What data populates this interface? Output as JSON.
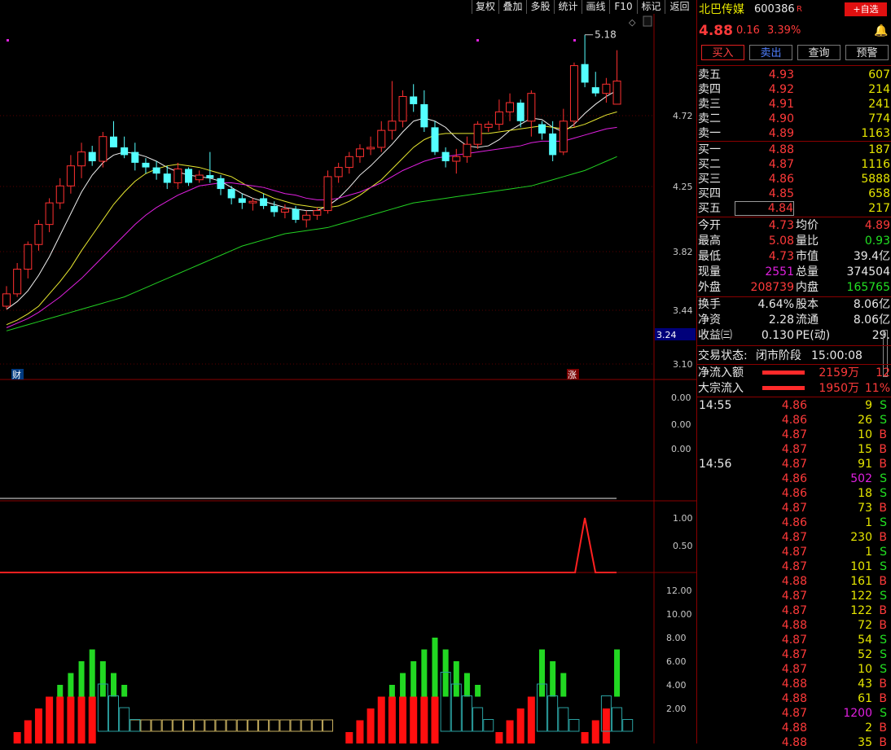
{
  "toolbar": [
    "复权",
    "叠加",
    "多股",
    "统计",
    "画线",
    "F10",
    "标记",
    "返回"
  ],
  "stock": {
    "name": "北巴传媒",
    "code": "600386",
    "flag": "R",
    "add_fav": "+自选",
    "price": "4.88",
    "change": "0.16",
    "pct": "3.39%"
  },
  "actions": [
    "买入",
    "卖出",
    "查询",
    "预警"
  ],
  "sells": [
    {
      "label": "卖五",
      "price": "4.93",
      "vol": "607"
    },
    {
      "label": "卖四",
      "price": "4.92",
      "vol": "214"
    },
    {
      "label": "卖三",
      "price": "4.91",
      "vol": "241"
    },
    {
      "label": "卖二",
      "price": "4.90",
      "vol": "774"
    },
    {
      "label": "卖一",
      "price": "4.89",
      "vol": "1163"
    }
  ],
  "buys": [
    {
      "label": "买一",
      "price": "4.88",
      "vol": "187"
    },
    {
      "label": "买二",
      "price": "4.87",
      "vol": "1116"
    },
    {
      "label": "买三",
      "price": "4.86",
      "vol": "5888"
    },
    {
      "label": "买四",
      "price": "4.85",
      "vol": "658"
    },
    {
      "label": "买五",
      "price": "4.84",
      "vol": "217"
    }
  ],
  "stats1": [
    {
      "l1": "今开",
      "v1": "4.73",
      "l2": "均价",
      "v2": "4.89"
    },
    {
      "l1": "最高",
      "v1": "5.08",
      "l2": "量比",
      "v2": "0.93"
    },
    {
      "l1": "最低",
      "v1": "4.73",
      "l2": "市值",
      "v2": "39.4亿"
    },
    {
      "l1": "现量",
      "v1": "2551",
      "l2": "总量",
      "v2": "374504"
    },
    {
      "l1": "外盘",
      "v1": "208739",
      "l2": "内盘",
      "v2": "165765"
    }
  ],
  "stats2": [
    {
      "l1": "换手",
      "v1": "4.64%",
      "l2": "股本",
      "v2": "8.06亿"
    },
    {
      "l1": "净资",
      "v1": "2.28",
      "l2": "流通",
      "v2": "8.06亿"
    },
    {
      "l1": "收益㈢",
      "v1": "0.130",
      "l2": "PE(动)",
      "v2": "29."
    }
  ],
  "status": {
    "label": "交易状态:",
    "value": "闭市阶段",
    "time": "15:00:08"
  },
  "flows": [
    {
      "label": "净流入额",
      "amount": "2159万",
      "pct": "12"
    },
    {
      "label": "大宗流入",
      "amount": "1950万",
      "pct": "11%"
    }
  ],
  "ticks": [
    {
      "time": "14:55",
      "price": "4.86",
      "vol": "9",
      "side": "S"
    },
    {
      "time": "",
      "price": "4.86",
      "vol": "26",
      "side": "S"
    },
    {
      "time": "",
      "price": "4.87",
      "vol": "10",
      "side": "B"
    },
    {
      "time": "",
      "price": "4.87",
      "vol": "15",
      "side": "B"
    },
    {
      "time": "14:56",
      "price": "4.87",
      "vol": "91",
      "side": "B"
    },
    {
      "time": "",
      "price": "4.86",
      "vol": "502",
      "side": "S"
    },
    {
      "time": "",
      "price": "4.86",
      "vol": "18",
      "side": "S"
    },
    {
      "time": "",
      "price": "4.87",
      "vol": "73",
      "side": "B"
    },
    {
      "time": "",
      "price": "4.86",
      "vol": "1",
      "side": "S"
    },
    {
      "time": "",
      "price": "4.87",
      "vol": "230",
      "side": "B"
    },
    {
      "time": "",
      "price": "4.87",
      "vol": "1",
      "side": "S"
    },
    {
      "time": "",
      "price": "4.87",
      "vol": "101",
      "side": "S"
    },
    {
      "time": "",
      "price": "4.88",
      "vol": "161",
      "side": "B"
    },
    {
      "time": "",
      "price": "4.87",
      "vol": "122",
      "side": "S"
    },
    {
      "time": "",
      "price": "4.87",
      "vol": "122",
      "side": "B"
    },
    {
      "time": "",
      "price": "4.88",
      "vol": "72",
      "side": "B"
    },
    {
      "time": "",
      "price": "4.87",
      "vol": "54",
      "side": "S"
    },
    {
      "time": "",
      "price": "4.87",
      "vol": "52",
      "side": "S"
    },
    {
      "time": "",
      "price": "4.87",
      "vol": "10",
      "side": "S"
    },
    {
      "time": "",
      "price": "4.88",
      "vol": "43",
      "side": "B"
    },
    {
      "time": "",
      "price": "4.88",
      "vol": "61",
      "side": "B"
    },
    {
      "time": "",
      "price": "4.87",
      "vol": "1200",
      "side": "S"
    },
    {
      "time": "",
      "price": "4.88",
      "vol": "2",
      "side": "B"
    },
    {
      "time": "",
      "price": "4.88",
      "vol": "35",
      "side": "B"
    }
  ],
  "chart": {
    "price_axis": [
      "4.72",
      "4.25",
      "3.82",
      "3.44",
      "3.10"
    ],
    "current_price_tag": "3.24",
    "high_label": "5.18",
    "marker_cai": "财",
    "marker_zhang": "涨",
    "panel2_axis": [
      "0.00",
      "0.00",
      "0.00"
    ],
    "panel3_axis": [
      "1.00",
      "0.50"
    ],
    "panel4_axis": [
      "12.00",
      "10.00",
      "8.00",
      "6.00",
      "4.00",
      "2.00"
    ]
  },
  "chart_data": {
    "type": "candlestick",
    "ylim": [
      2.95,
      5.3
    ],
    "candles": [
      [
        3.42,
        3.55,
        3.4,
        3.5
      ],
      [
        3.5,
        3.7,
        3.48,
        3.66
      ],
      [
        3.66,
        3.84,
        3.6,
        3.82
      ],
      [
        3.82,
        3.98,
        3.78,
        3.95
      ],
      [
        3.95,
        4.12,
        3.9,
        4.09
      ],
      [
        4.09,
        4.25,
        4.05,
        4.2
      ],
      [
        4.2,
        4.4,
        4.15,
        4.33
      ],
      [
        4.33,
        4.48,
        4.25,
        4.42
      ],
      [
        4.42,
        4.46,
        4.33,
        4.36
      ],
      [
        4.36,
        4.55,
        4.32,
        4.52
      ],
      [
        4.52,
        4.62,
        4.45,
        4.45
      ],
      [
        4.45,
        4.52,
        4.38,
        4.4
      ],
      [
        4.42,
        4.48,
        4.3,
        4.35
      ],
      [
        4.35,
        4.38,
        4.28,
        4.32
      ],
      [
        4.32,
        4.36,
        4.24,
        4.28
      ],
      [
        4.28,
        4.33,
        4.18,
        4.22
      ],
      [
        4.22,
        4.35,
        4.18,
        4.31
      ],
      [
        4.31,
        4.32,
        4.2,
        4.22
      ],
      [
        4.24,
        4.3,
        4.22,
        4.27
      ],
      [
        4.27,
        4.42,
        4.22,
        4.25
      ],
      [
        4.25,
        4.27,
        4.14,
        4.18
      ],
      [
        4.18,
        4.2,
        4.08,
        4.12
      ],
      [
        4.12,
        4.15,
        4.05,
        4.09
      ],
      [
        4.09,
        4.12,
        4.04,
        4.1
      ],
      [
        4.12,
        4.15,
        4.05,
        4.07
      ],
      [
        4.07,
        4.1,
        4.0,
        4.03
      ],
      [
        4.03,
        4.08,
        3.99,
        4.05
      ],
      [
        4.05,
        4.07,
        3.96,
        3.98
      ],
      [
        3.98,
        4.04,
        3.93,
        4.01
      ],
      [
        4.01,
        4.06,
        3.98,
        4.04
      ],
      [
        4.04,
        4.3,
        4.02,
        4.26
      ],
      [
        4.26,
        4.35,
        4.22,
        4.32
      ],
      [
        4.32,
        4.42,
        4.28,
        4.39
      ],
      [
        4.39,
        4.47,
        4.35,
        4.44
      ],
      [
        4.44,
        4.52,
        4.4,
        4.45
      ],
      [
        4.45,
        4.62,
        4.42,
        4.56
      ],
      [
        4.56,
        4.88,
        4.5,
        4.62
      ],
      [
        4.62,
        4.82,
        4.58,
        4.78
      ],
      [
        4.78,
        4.86,
        4.68,
        4.73
      ],
      [
        4.73,
        4.82,
        4.55,
        4.58
      ],
      [
        4.58,
        4.62,
        4.4,
        4.42
      ],
      [
        4.42,
        4.45,
        4.32,
        4.36
      ],
      [
        4.36,
        4.44,
        4.28,
        4.39
      ],
      [
        4.39,
        4.52,
        4.35,
        4.47
      ],
      [
        4.47,
        4.62,
        4.44,
        4.6
      ],
      [
        4.58,
        4.62,
        4.55,
        4.6
      ],
      [
        4.6,
        4.76,
        4.56,
        4.68
      ],
      [
        4.68,
        4.8,
        4.62,
        4.74
      ],
      [
        4.74,
        4.76,
        4.58,
        4.62
      ],
      [
        4.62,
        4.82,
        4.52,
        4.8
      ],
      [
        4.6,
        4.62,
        4.5,
        4.54
      ],
      [
        4.54,
        4.62,
        4.36,
        4.4
      ],
      [
        4.42,
        4.7,
        4.4,
        4.62
      ],
      [
        4.62,
        5.0,
        4.58,
        4.98
      ],
      [
        4.99,
        5.18,
        4.84,
        4.87
      ],
      [
        4.84,
        4.94,
        4.78,
        4.8
      ],
      [
        4.8,
        4.9,
        4.74,
        4.86
      ],
      [
        4.73,
        5.08,
        4.73,
        4.88
      ]
    ],
    "ma_lines": [
      {
        "color": "#f0f0f0",
        "values": [
          3.4,
          3.45,
          3.52,
          3.62,
          3.74,
          3.88,
          4.02,
          4.16,
          4.27,
          4.35,
          4.4,
          4.42,
          4.41,
          4.39,
          4.36,
          4.32,
          4.29,
          4.27,
          4.26,
          4.25,
          4.23,
          4.19,
          4.15,
          4.12,
          4.1,
          4.08,
          4.06,
          4.05,
          4.04,
          4.04,
          4.07,
          4.12,
          4.19,
          4.27,
          4.33,
          4.4,
          4.47,
          4.55,
          4.62,
          4.64,
          4.62,
          4.58,
          4.51,
          4.46,
          4.45,
          4.46,
          4.5,
          4.56,
          4.6,
          4.64,
          4.63,
          4.58,
          4.55,
          4.6,
          4.67,
          4.73,
          4.78,
          4.82
        ]
      },
      {
        "color": "#e8e830",
        "values": [
          3.3,
          3.33,
          3.37,
          3.42,
          3.5,
          3.58,
          3.67,
          3.78,
          3.88,
          3.98,
          4.08,
          4.16,
          4.23,
          4.28,
          4.31,
          4.33,
          4.34,
          4.33,
          4.32,
          4.3,
          4.28,
          4.26,
          4.22,
          4.18,
          4.15,
          4.12,
          4.1,
          4.08,
          4.07,
          4.06,
          4.06,
          4.07,
          4.1,
          4.14,
          4.19,
          4.24,
          4.31,
          4.38,
          4.45,
          4.5,
          4.53,
          4.54,
          4.54,
          4.54,
          4.54,
          4.54,
          4.55,
          4.56,
          4.57,
          4.58,
          4.59,
          4.58,
          4.57,
          4.58,
          4.6,
          4.63,
          4.66,
          4.68
        ]
      },
      {
        "color": "#e020e0",
        "values": [
          3.28,
          3.31,
          3.34,
          3.38,
          3.43,
          3.48,
          3.54,
          3.6,
          3.67,
          3.74,
          3.81,
          3.88,
          3.95,
          4.01,
          4.06,
          4.1,
          4.14,
          4.17,
          4.2,
          4.21,
          4.22,
          4.22,
          4.21,
          4.2,
          4.19,
          4.17,
          4.15,
          4.14,
          4.12,
          4.11,
          4.11,
          4.12,
          4.14,
          4.16,
          4.19,
          4.22,
          4.26,
          4.3,
          4.33,
          4.36,
          4.38,
          4.39,
          4.4,
          4.41,
          4.42,
          4.43,
          4.44,
          4.45,
          4.46,
          4.48,
          4.49,
          4.49,
          4.49,
          4.51,
          4.53,
          4.55,
          4.57,
          4.58
        ]
      },
      {
        "color": "#22d022",
        "values": [
          3.26,
          3.28,
          3.3,
          3.32,
          3.34,
          3.36,
          3.38,
          3.4,
          3.42,
          3.44,
          3.46,
          3.48,
          3.51,
          3.54,
          3.57,
          3.6,
          3.63,
          3.66,
          3.69,
          3.72,
          3.75,
          3.78,
          3.81,
          3.83,
          3.85,
          3.87,
          3.89,
          3.9,
          3.91,
          3.92,
          3.93,
          3.95,
          3.97,
          3.99,
          4.01,
          4.03,
          4.05,
          4.07,
          4.09,
          4.1,
          4.11,
          4.12,
          4.13,
          4.14,
          4.15,
          4.16,
          4.17,
          4.18,
          4.19,
          4.2,
          4.22,
          4.24,
          4.26,
          4.28,
          4.3,
          4.33,
          4.36,
          4.39
        ]
      }
    ],
    "panel3_signal_index": 54,
    "panel4_values": [
      [
        1,
        0
      ],
      [
        2,
        0
      ],
      [
        3,
        0
      ],
      [
        4,
        0
      ],
      [
        5,
        0
      ],
      [
        5,
        1
      ],
      [
        5,
        2
      ],
      [
        5,
        3
      ],
      [
        5,
        4
      ],
      [
        0,
        3
      ],
      [
        0,
        2
      ],
      [
        0,
        1
      ],
      [
        0,
        0
      ],
      [
        0,
        0
      ],
      [
        0,
        0
      ],
      [
        0,
        0
      ],
      [
        0,
        0
      ],
      [
        0,
        0
      ],
      [
        0,
        0
      ],
      [
        0,
        0
      ],
      [
        0,
        0
      ],
      [
        0,
        0
      ],
      [
        0,
        0
      ],
      [
        0,
        0
      ],
      [
        0,
        0
      ],
      [
        0,
        0
      ],
      [
        0,
        0
      ],
      [
        0,
        0
      ],
      [
        0,
        0
      ],
      [
        0,
        0
      ],
      [
        0,
        0
      ],
      [
        1,
        0
      ],
      [
        2,
        0
      ],
      [
        3,
        0
      ],
      [
        4,
        0
      ],
      [
        5,
        0
      ],
      [
        5,
        1
      ],
      [
        5,
        2
      ],
      [
        5,
        3
      ],
      [
        5,
        4
      ],
      [
        5,
        5
      ],
      [
        0,
        4
      ],
      [
        0,
        3
      ],
      [
        0,
        2
      ],
      [
        0,
        1
      ],
      [
        1,
        0
      ],
      [
        2,
        0
      ],
      [
        3,
        0
      ],
      [
        4,
        0
      ],
      [
        5,
        0
      ],
      [
        0,
        4
      ],
      [
        0,
        3
      ],
      [
        0,
        2
      ],
      [
        1,
        0
      ],
      [
        2,
        0
      ],
      [
        3,
        0
      ],
      [
        4,
        0
      ],
      [
        1,
        4
      ]
    ]
  }
}
